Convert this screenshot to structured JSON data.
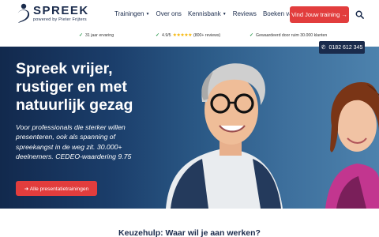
{
  "brand": {
    "name": "SPREEK",
    "tagline": "powered by Pieter Frijters"
  },
  "nav": {
    "items": [
      {
        "label": "Trainingen",
        "has_dropdown": true
      },
      {
        "label": "Over ons",
        "has_dropdown": false
      },
      {
        "label": "Kennisbank",
        "has_dropdown": true
      },
      {
        "label": "Reviews",
        "has_dropdown": false
      },
      {
        "label": "Boeken van Pieter",
        "has_dropdown": false
      }
    ],
    "cta_label": "Vind Jouw training →",
    "search_icon": "search-icon"
  },
  "trust": {
    "experience": "31 jaar ervaring",
    "rating_score": "4.9/5",
    "rating_stars": "★★★★★",
    "rating_count": "(800+ reviews)",
    "customers": "Gewaardeerd door ruim 30.000 klanten"
  },
  "hero": {
    "title": "Spreek vrijer, rustiger en met natuurlijk gezag",
    "subtitle": "Voor professionals die sterker willen presenteren, ook als spanning of spreekangst in de weg zit. 30.000+ deelnemers. CEDEO-waardering 9.75",
    "button_label": "➜ Alle presentatietrainingen",
    "phone": "0182 612 345"
  },
  "next_section": {
    "title": "Keuzehulp: Waar wil je aan werken?"
  },
  "colors": {
    "accent": "#e23d3d",
    "navy": "#1a2b4c",
    "hero_dark": "#12294d",
    "hero_light": "#4d82ad",
    "check_green": "#2e9b4f",
    "star_gold": "#f5b400"
  }
}
